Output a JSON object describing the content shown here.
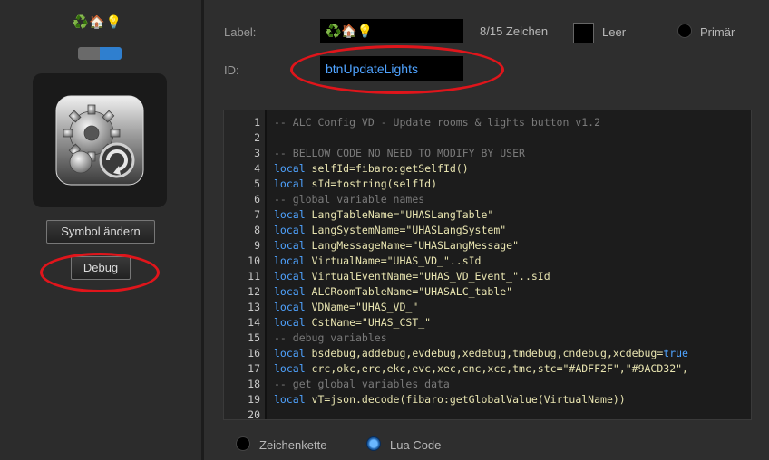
{
  "left": {
    "label_emojis": "♻️🏠💡",
    "symbol_button": "Symbol ändern",
    "debug_button": "Debug"
  },
  "form": {
    "label_caption": "Label:",
    "label_value": "♻️🏠💡",
    "char_count": "8/15 Zeichen",
    "leer_label": "Leer",
    "primar_label": "Primär",
    "id_caption": "ID:",
    "id_value": "btnUpdateLights"
  },
  "code": {
    "lines": [
      {
        "n": "1",
        "t": "-- ALC Config VD - Update rooms & lights button v1.2"
      },
      {
        "n": "2",
        "t": ""
      },
      {
        "n": "3",
        "t": "-- BELLOW CODE NO NEED TO MODIFY BY USER"
      },
      {
        "n": "4",
        "kw": "local",
        "t": " selfId=fibaro:getSelfId()"
      },
      {
        "n": "5",
        "kw": "local",
        "t": " sId=tostring(selfId)"
      },
      {
        "n": "6",
        "t": "-- global variable names"
      },
      {
        "n": "7",
        "kw": "local",
        "t": " LangTableName=\"UHASLangTable\""
      },
      {
        "n": "8",
        "kw": "local",
        "t": " LangSystemName=\"UHASLangSystem\""
      },
      {
        "n": "9",
        "kw": "local",
        "t": " LangMessageName=\"UHASLangMessage\""
      },
      {
        "n": "10",
        "kw": "local",
        "t": " VirtualName=\"UHAS_VD_\"..sId"
      },
      {
        "n": "11",
        "kw": "local",
        "t": " VirtualEventName=\"UHAS_VD_Event_\"..sId"
      },
      {
        "n": "12",
        "kw": "local",
        "t": " ALCRoomTableName=\"UHASALC_table\""
      },
      {
        "n": "13",
        "kw": "local",
        "t": " VDName=\"UHAS_VD_\""
      },
      {
        "n": "14",
        "kw": "local",
        "t": " CstName=\"UHAS_CST_\""
      },
      {
        "n": "15",
        "t": "-- debug variables"
      },
      {
        "n": "16",
        "kw": "local",
        "t": " bsdebug,addebug,evdebug,xedebug,tmdebug,cndebug,xcdebug=",
        "tail": "true"
      },
      {
        "n": "17",
        "kw": "local",
        "t": " crc,okc,erc,ekc,evc,xec,cnc,xcc,tmc,stc=\"#ADFF2F\",\"#9ACD32\","
      },
      {
        "n": "18",
        "t": "-- get global variables data"
      },
      {
        "n": "19",
        "kw": "local",
        "t": " vT=json.decode(fibaro:getGlobalValue(VirtualName))"
      },
      {
        "n": "20",
        "t": ""
      }
    ]
  },
  "bottom": {
    "zeichenkette_label": "Zeichenkette",
    "lua_label": "Lua Code"
  },
  "colors": {
    "accent_blue": "#2f7fcf",
    "highlight_red": "#e0151b",
    "keyword": "#4fa3ff"
  }
}
